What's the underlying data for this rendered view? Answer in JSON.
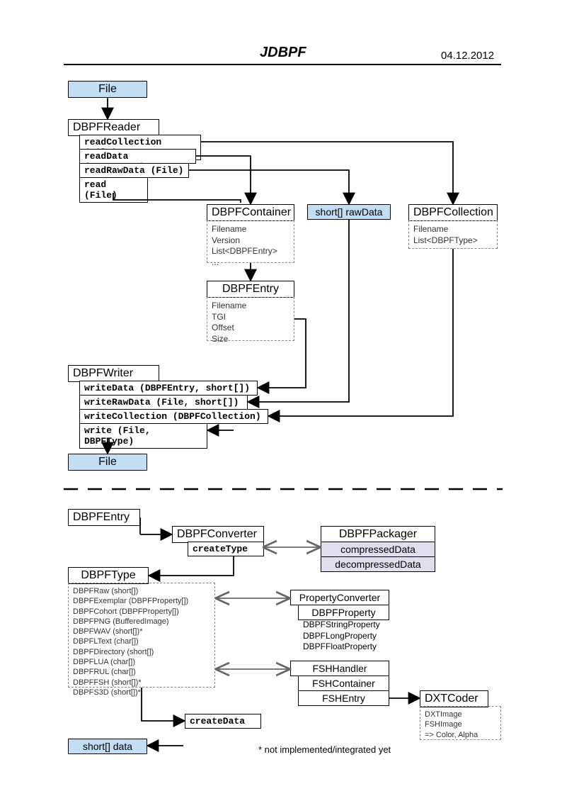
{
  "header": {
    "title": "JDBPF",
    "date": "04.12.2012"
  },
  "top": {
    "file": "File",
    "dbpfreader": "DBPFReader",
    "readCollection": "readCollection (File)",
    "readData": "readData (DBPFEntry)",
    "readRawData": "readRawData (File)",
    "read": "read (File)",
    "dbpfcontainer": "DBPFContainer",
    "dbpfcontainer_fields": "Filename\nVersion\nList<DBPFEntry>\n...",
    "rawdata": "short[] rawData",
    "dbpfcollection": "DBPFCollection",
    "dbpfcollection_fields": "Filename\nList<DBPFType>",
    "dbpfentry": "DBPFEntry",
    "dbpfentry_fields": "Filename\nTGI\nOffset\nSize",
    "dbpfwriter": "DBPFWriter",
    "writeData": "writeData (DBPFEntry, short[])",
    "writeRawData": "writeRawData (File, short[])",
    "writeCollection": "writeCollection (DBPFCollection)",
    "write": "write (File, DBPFType)",
    "file2": "File"
  },
  "bottom": {
    "dbpfentry2": "DBPFEntry",
    "dbpfconverter": "DBPFConverter",
    "createType": "createType",
    "dbpfpackager": "DBPFPackager",
    "compressedData": "compressedData",
    "decompressedData": "decompressedData",
    "dbpftype": "DBPFType",
    "dbpftype_list": "DBPFRaw (short[])\nDBPFExemplar (DBPFProperty[])\nDBPFCohort (DBPFProperty[])\nDBPFPNG (BufferedImage)\nDBPFWAV (short[])*\nDBPFLText (char[])\nDBPFDirectory (short[])\nDBPFLUA (char[])\nDBPFRUL (char[])\nDBPFFSH (short[])*\nDBPFS3D (short[])*",
    "propertyconverter": "PropertyConverter",
    "dbpfproperty": "DBPFProperty",
    "dbpfproperty_sub": "DBPFStringProperty\nDBPFLongProperty\nDBPFFloatProperty",
    "fshhandler": "FSHHandler",
    "fshcontainer": "FSHContainer",
    "fshentry": "FSHEntry",
    "dxtcoder": "DXTCoder",
    "dxtcoder_fields": "DXTImage\nFSHImage\n=> Color, Alpha",
    "createData": "createData",
    "shortdata": "short[] data",
    "footnote": "* not implemented/integrated yet"
  }
}
